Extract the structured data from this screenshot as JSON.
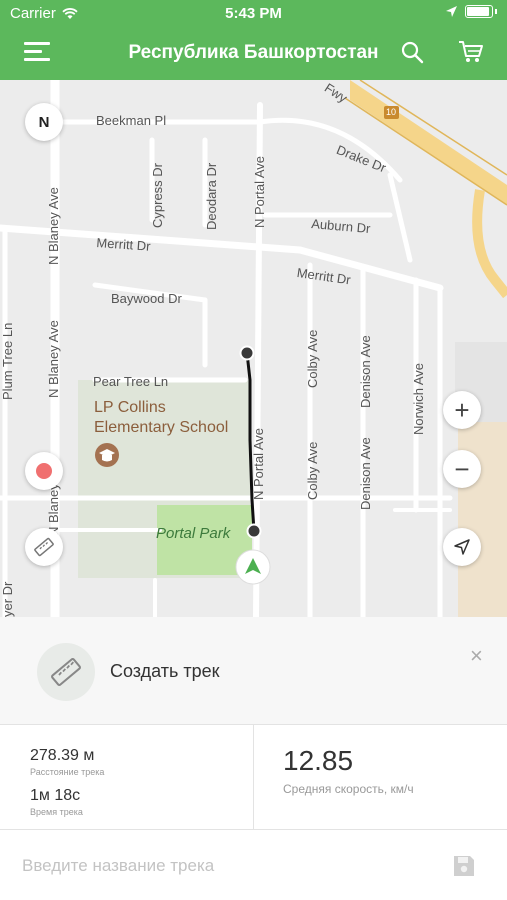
{
  "status": {
    "carrier": "Carrier",
    "time": "5:43 PM"
  },
  "nav": {
    "title": "Республика Башкортостан"
  },
  "map": {
    "compass": "N",
    "zoom_in": "+",
    "zoom_out": "−",
    "school": [
      "LP Collins",
      "Elementary School"
    ],
    "park": "Portal Park",
    "streets": {
      "beekman": "Beekman Pl",
      "drake": "Drake Dr",
      "cypress": "Cypress Dr",
      "deodara": "Deodara Dr",
      "auburn": "Auburn Dr",
      "merritt1": "Merritt Dr",
      "merritt2": "Merritt Dr",
      "baywood": "Baywood Dr",
      "pear": "Pear Tree Ln",
      "blaney1": "N Blaney Ave",
      "blaney2": "N Blaney Ave",
      "blaney3": "N Blaney Ave",
      "portal1": "N Portal Ave",
      "portal2": "N Portal Ave",
      "colby1": "Colby Ave",
      "colby2": "Colby Ave",
      "denison1": "Denison Ave",
      "denison2": "Denison Ave",
      "norwich": "Norwich Ave",
      "plumtree": "Plum Tree Ln",
      "fwy": "Fwy",
      "hwy": "10",
      "ayer": "yer Dr"
    }
  },
  "track": {
    "create_label": "Создать трек",
    "close": "×",
    "distance_value": "278.39 м",
    "distance_caption": "Расстояние трека",
    "time_value": "1м 18с",
    "time_caption": "Время трека",
    "speed_value": "12.85",
    "speed_caption": "Средняя скорость, км/ч",
    "name_placeholder": "Введите название трека"
  },
  "colors": {
    "accent": "#5cb85c",
    "park": "#bfe3a5",
    "school": "#dfe5d9"
  }
}
